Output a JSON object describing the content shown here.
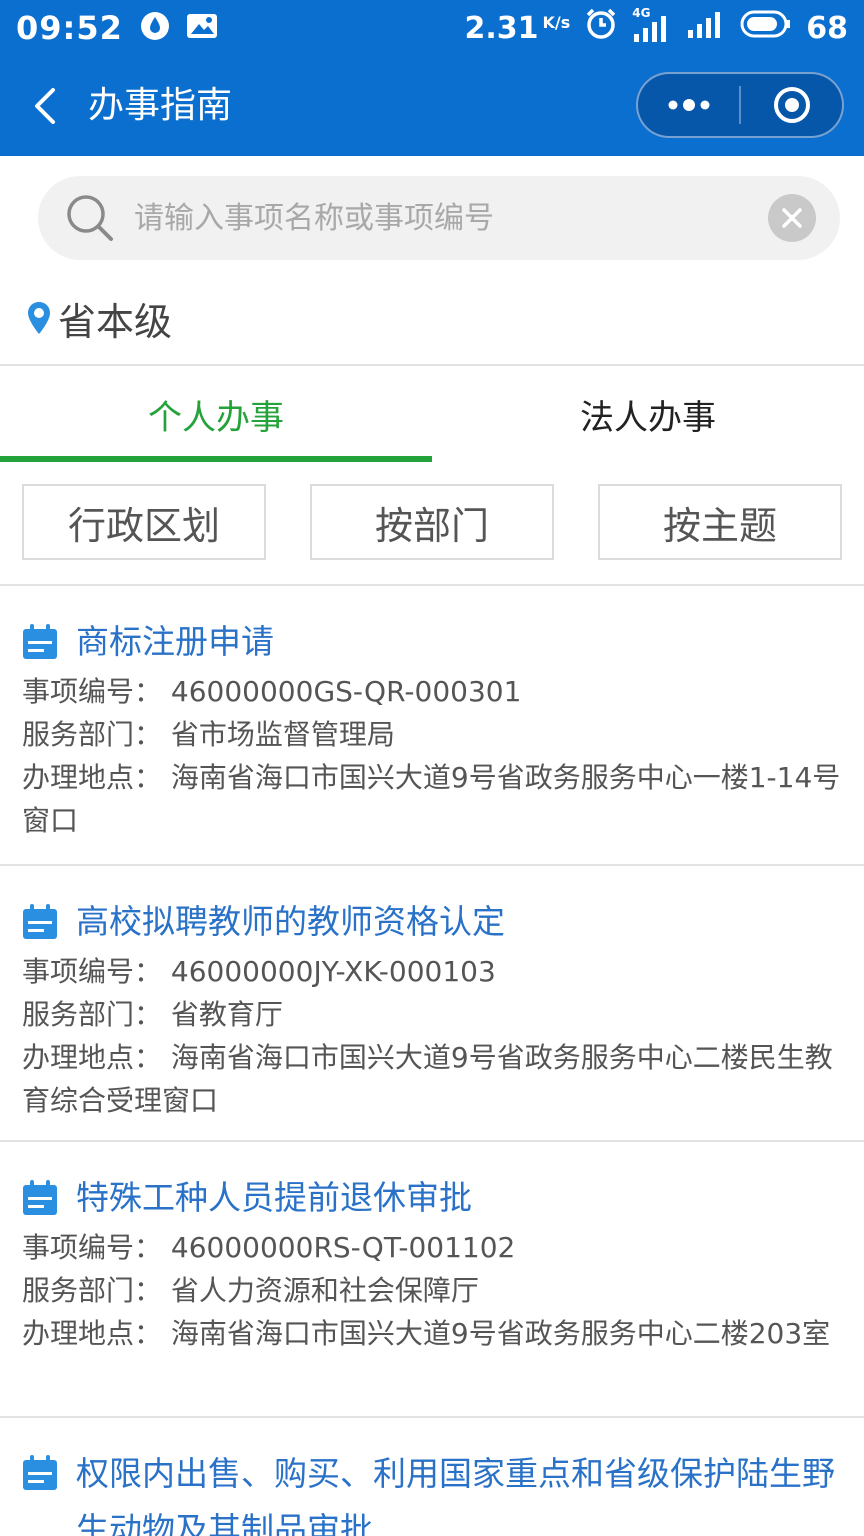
{
  "status_bar": {
    "time": "09:52",
    "speed": "2.31",
    "speed_unit": "K/s",
    "network": "4G",
    "battery": "68"
  },
  "nav": {
    "title": "办事指南"
  },
  "search": {
    "placeholder": "请输入事项名称或事项编号",
    "value": ""
  },
  "location": {
    "label": "省本级"
  },
  "tabs": [
    {
      "label": "个人办事",
      "active": true
    },
    {
      "label": "法人办事",
      "active": false
    }
  ],
  "filters": [
    {
      "label": "行政区划"
    },
    {
      "label": "按部门"
    },
    {
      "label": "按主题"
    }
  ],
  "labels": {
    "code": "事项编号：",
    "dept": "服务部门：",
    "place": "办理地点："
  },
  "items": [
    {
      "title": "商标注册申请",
      "code": "46000000GS-QR-000301",
      "dept": "省市场监督管理局",
      "place": "海南省海口市国兴大道9号省政务服务中心一楼1-14号窗口"
    },
    {
      "title": "高校拟聘教师的教师资格认定",
      "code": "46000000JY-XK-000103",
      "dept": "省教育厅",
      "place": "海南省海口市国兴大道9号省政务服务中心二楼民生教育综合受理窗口"
    },
    {
      "title": "特殊工种人员提前退休审批",
      "code": "46000000RS-QT-001102",
      "dept": "省人力资源和社会保障厅",
      "place": "海南省海口市国兴大道9号省政务服务中心二楼203室"
    },
    {
      "title": "权限内出售、购买、利用国家重点和省级保护陆生野生动物及其制品审批"
    }
  ],
  "colors": {
    "primary": "#0a6fcf",
    "tab_active": "#24a33a",
    "item_title": "#2a72c8"
  }
}
